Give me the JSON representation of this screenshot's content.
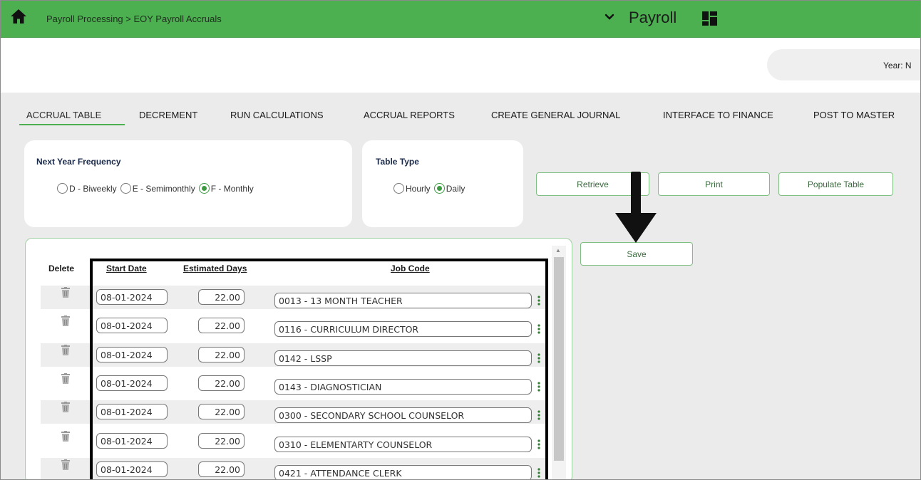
{
  "header": {
    "breadcrumb": "Payroll Processing > EOY Payroll Accruals",
    "module_title": "Payroll",
    "home_icon": "home-icon",
    "chevron_icon": "chevron-down-icon",
    "grid_icon": "grid-icon"
  },
  "year": {
    "label": "Year: N"
  },
  "tabs": [
    {
      "label": "ACCRUAL TABLE",
      "active": true
    },
    {
      "label": "DECREMENT"
    },
    {
      "label": "RUN CALCULATIONS"
    },
    {
      "label": "ACCRUAL REPORTS"
    },
    {
      "label": "CREATE GENERAL JOURNAL"
    },
    {
      "label": "INTERFACE TO FINANCE"
    },
    {
      "label": "POST TO MASTER"
    }
  ],
  "frequency": {
    "title": "Next Year Frequency",
    "options": [
      "D - Biweekly",
      "E - Semimonthly",
      "F - Monthly"
    ],
    "selected": "F - Monthly"
  },
  "table_type": {
    "title": "Table Type",
    "options": [
      "Hourly",
      "Daily"
    ],
    "selected": "Daily"
  },
  "buttons": {
    "retrieve": "Retrieve",
    "print": "Print",
    "populate": "Populate Table",
    "save": "Save"
  },
  "grid": {
    "columns": {
      "delete": "Delete",
      "start_date": "Start Date",
      "estimated_days": "Estimated Days",
      "job_code": "Job Code"
    },
    "rows": [
      {
        "start_date": "08-01-2024",
        "days": "22.00",
        "job_code": "0013 - 13 MONTH TEACHER"
      },
      {
        "start_date": "08-01-2024",
        "days": "22.00",
        "job_code": "0116 - CURRICULUM DIRECTOR"
      },
      {
        "start_date": "08-01-2024",
        "days": "22.00",
        "job_code": "0142 - LSSP"
      },
      {
        "start_date": "08-01-2024",
        "days": "22.00",
        "job_code": "0143 - DIAGNOSTICIAN"
      },
      {
        "start_date": "08-01-2024",
        "days": "22.00",
        "job_code": "0300 - SECONDARY SCHOOL COUNSELOR"
      },
      {
        "start_date": "08-01-2024",
        "days": "22.00",
        "job_code": "0310 - ELEMENTARTY COUNSELOR"
      },
      {
        "start_date": "08-01-2024",
        "days": "22.00",
        "job_code": "0421 - ATTENDANCE CLERK"
      }
    ]
  },
  "colors": {
    "header_green": "#4caf50",
    "accent_green": "#3c9b40",
    "content_gray": "#ebebeb"
  }
}
